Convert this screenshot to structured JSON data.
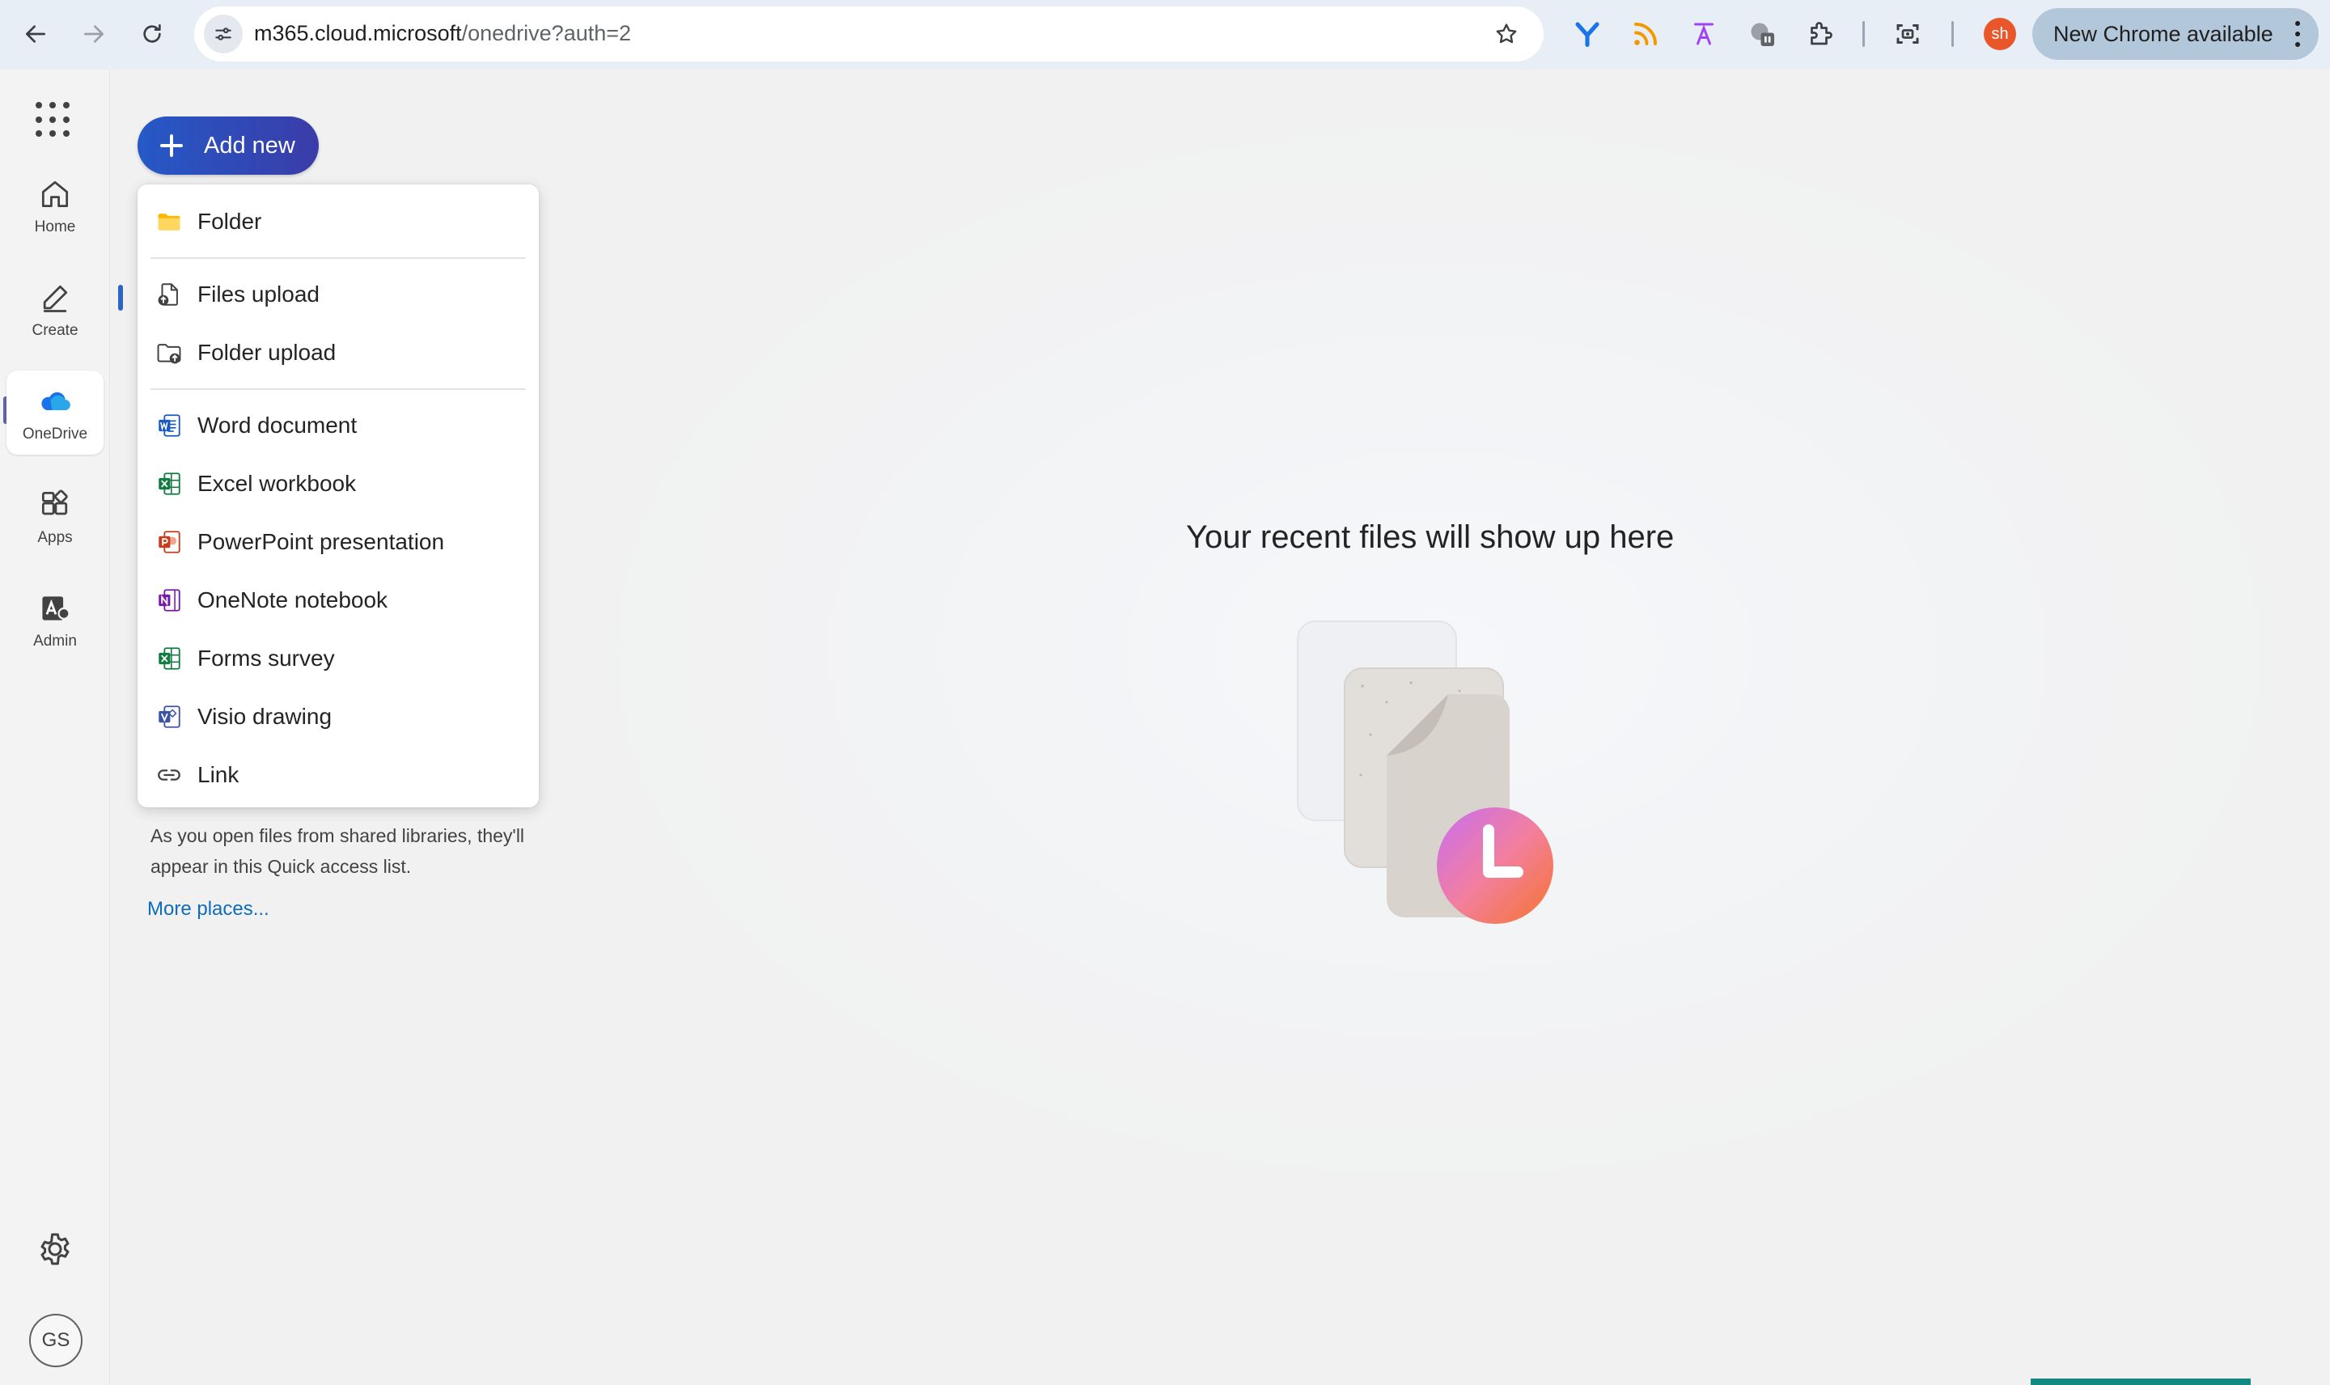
{
  "browser": {
    "url_host": "m365.cloud.microsoft",
    "url_path": "/onedrive?auth=2",
    "profile_initials": "sh",
    "update_label": "New Chrome available"
  },
  "rail": {
    "items": [
      {
        "label": "Home"
      },
      {
        "label": "Create"
      },
      {
        "label": "OneDrive"
      },
      {
        "label": "Apps"
      },
      {
        "label": "Admin"
      }
    ],
    "avatar_initials": "GS"
  },
  "toolbar": {
    "add_new_label": "Add new"
  },
  "add_menu": {
    "items": [
      {
        "label": "Folder",
        "icon": "folder-icon"
      },
      {
        "label": "Files upload",
        "icon": "file-upload-icon"
      },
      {
        "label": "Folder upload",
        "icon": "folder-upload-icon"
      },
      {
        "label": "Word document",
        "icon": "word-icon"
      },
      {
        "label": "Excel workbook",
        "icon": "excel-icon"
      },
      {
        "label": "PowerPoint presentation",
        "icon": "powerpoint-icon"
      },
      {
        "label": "OneNote notebook",
        "icon": "onenote-icon"
      },
      {
        "label": "Forms survey",
        "icon": "forms-icon"
      },
      {
        "label": "Visio drawing",
        "icon": "visio-icon"
      },
      {
        "label": "Link",
        "icon": "link-icon"
      }
    ]
  },
  "quick_access": {
    "description": "As you open files from shared libraries, they'll appear in this Quick access list.",
    "more_places": "More places..."
  },
  "main": {
    "empty_title": "Your recent files will show up here"
  },
  "colors": {
    "accent": "#2559c7",
    "word": "#185abd",
    "excel": "#107c41",
    "powerpoint": "#c43e1c",
    "onenote": "#7719aa",
    "visio": "#3955a3",
    "link": "#0f6cbd"
  }
}
